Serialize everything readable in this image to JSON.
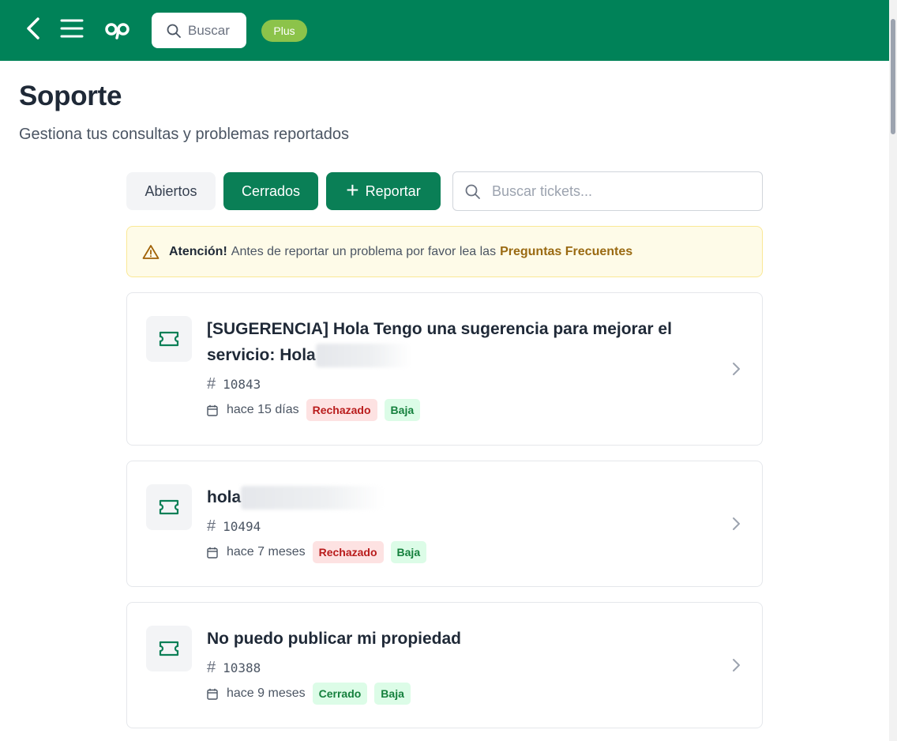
{
  "header": {
    "search_label": "Buscar",
    "plan_badge": "Plus",
    "brand_color": "#008258"
  },
  "page": {
    "title": "Soporte",
    "subtitle": "Gestiona tus consultas y problemas reportados"
  },
  "toolbar": {
    "open_label": "Abiertos",
    "closed_label": "Cerrados",
    "report_label": "Reportar",
    "search_placeholder": "Buscar tickets...",
    "active_filter": "Cerrados"
  },
  "alert": {
    "title": "Atención!",
    "text": "Antes de reportar un problema por favor lea las",
    "link": "Preguntas Frecuentes"
  },
  "tickets": [
    {
      "title_line1": "[SUGERENCIA] Hola Tengo una sugerencia para mejorar el",
      "title_line2": "servicio: Hola",
      "id": "10843",
      "date": "hace 15 días",
      "status": "Rechazado",
      "priority": "Baja"
    },
    {
      "title": "hola",
      "id": "10494",
      "date": "hace 7 meses",
      "status": "Rechazado",
      "priority": "Baja"
    },
    {
      "title": "No puedo publicar mi propiedad",
      "id": "10388",
      "date": "hace 9 meses",
      "status": "Cerrado",
      "priority": "Baja"
    }
  ]
}
